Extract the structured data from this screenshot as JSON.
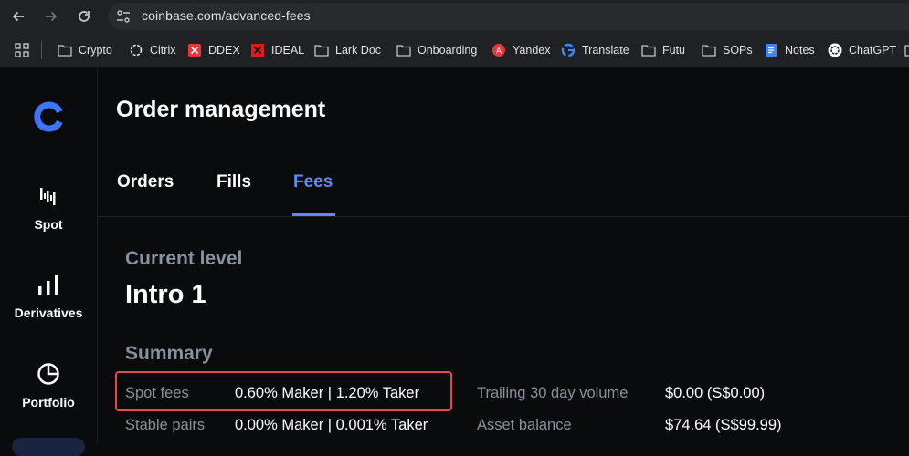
{
  "browser": {
    "url": "coinbase.com/advanced-fees",
    "bookmarks": [
      {
        "label": "Crypto",
        "icon": "folder-icon"
      },
      {
        "label": "Citrix",
        "icon": "citrix-icon"
      },
      {
        "label": "DDEX",
        "icon": "ddex-icon"
      },
      {
        "label": "IDEAL",
        "icon": "ideal-icon"
      },
      {
        "label": "Lark Doc",
        "icon": "folder-icon"
      },
      {
        "label": "Onboarding",
        "icon": "folder-icon"
      },
      {
        "label": "Yandex",
        "icon": "yandex-translate-icon"
      },
      {
        "label": "Translate",
        "icon": "google-icon"
      },
      {
        "label": "Futu",
        "icon": "folder-icon"
      },
      {
        "label": "SOPs",
        "icon": "folder-icon"
      },
      {
        "label": "Notes",
        "icon": "docs-icon"
      },
      {
        "label": "ChatGPT",
        "icon": "chatgpt-icon"
      }
    ]
  },
  "sidebar": {
    "items": [
      {
        "label": "Spot",
        "icon": "candlestick-icon"
      },
      {
        "label": "Derivatives",
        "icon": "bar-chart-icon"
      },
      {
        "label": "Portfolio",
        "icon": "pie-chart-icon"
      }
    ]
  },
  "page": {
    "title": "Order management",
    "tabs": [
      {
        "label": "Orders",
        "active": false
      },
      {
        "label": "Fills",
        "active": false
      },
      {
        "label": "Fees",
        "active": true
      }
    ],
    "current_level_heading": "Current level",
    "current_level": "Intro 1",
    "summary_heading": "Summary",
    "summary": {
      "spot_fees_label": "Spot fees",
      "spot_fees_value": "0.60% Maker | 1.20% Taker",
      "stable_pairs_label": "Stable pairs",
      "stable_pairs_value": "0.00% Maker | 0.001% Taker",
      "trailing_volume_label": "Trailing 30 day volume",
      "trailing_volume_value": "$0.00 (S$0.00)",
      "asset_balance_label": "Asset balance",
      "asset_balance_value": "$74.64 (S$99.99)"
    }
  },
  "colors": {
    "accent": "#5b8cf7",
    "highlight": "#e5484d",
    "background": "#0a0b0d",
    "muted_text": "#8a919e"
  }
}
